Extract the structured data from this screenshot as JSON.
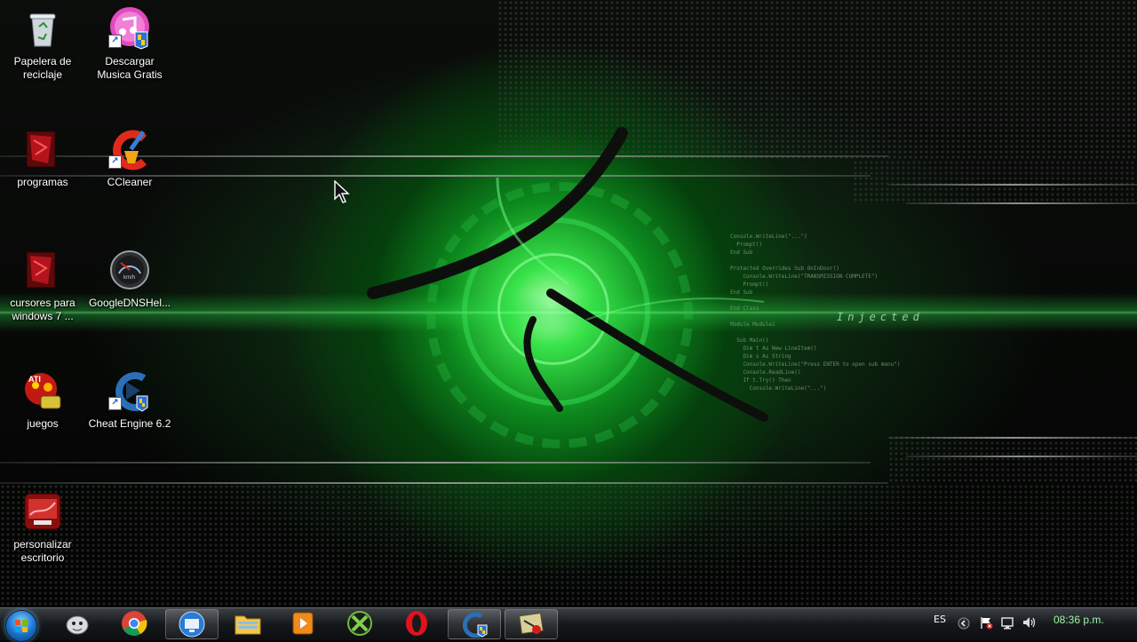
{
  "desktop": {
    "icons": [
      {
        "label": "Papelera de reciclaje",
        "icon": "recycle-bin-icon"
      },
      {
        "label": "Descargar Musica Gratis",
        "icon": "music-download-icon"
      },
      {
        "label": "programas",
        "icon": "folder-red-icon"
      },
      {
        "label": "CCleaner",
        "icon": "ccleaner-icon"
      },
      {
        "label": "cursores para windows 7 ...",
        "icon": "folder-red-icon"
      },
      {
        "label": "GoogleDNSHel...",
        "icon": "speedometer-icon"
      },
      {
        "label": "juegos",
        "icon": "games-folder-icon"
      },
      {
        "label": "Cheat Engine 6.2",
        "icon": "cheat-engine-icon"
      },
      {
        "label": "personalizar escritorio",
        "icon": "personalize-icon"
      }
    ],
    "wallpaper": {
      "overlay_text": "Injected",
      "code_lines": "Console.WriteLine(\"...\")\n  Prompt()\nEnd Sub\n\nProtected Overrides Sub OnInDoor()\n    Console.WriteLine(\"TRANSMISSION COMPLETE\")\n    Prompt()\nEnd Sub\n\nEnd Class\n\nModule Module1\n\n  Sub Main()\n    Dim t As New LineItem()\n    Dim s As String\n    Console.WriteLine(\"Press ENTER to open sub menu\")\n    Console.ReadLine()\n    If t.Try() Then\n      Console.WriteLine(\"...\")",
      "accent_color": "#33e04a"
    }
  },
  "taskbar": {
    "pinned": [
      {
        "name": "start",
        "icon": "windows-orb-icon"
      },
      {
        "name": "cleaner",
        "icon": "mascot-icon"
      },
      {
        "name": "chrome",
        "icon": "chrome-icon"
      },
      {
        "name": "desktop-manager",
        "icon": "monitor-icon"
      },
      {
        "name": "explorer",
        "icon": "folder-icon"
      },
      {
        "name": "media-player",
        "icon": "media-player-icon"
      },
      {
        "name": "xbox",
        "icon": "xbox-icon"
      },
      {
        "name": "opera",
        "icon": "opera-icon"
      },
      {
        "name": "cheat-engine",
        "icon": "cheat-engine-icon"
      },
      {
        "name": "app",
        "icon": "app-window-icon"
      }
    ],
    "tray": {
      "language": "ES",
      "time": "08:36 p.m."
    }
  }
}
